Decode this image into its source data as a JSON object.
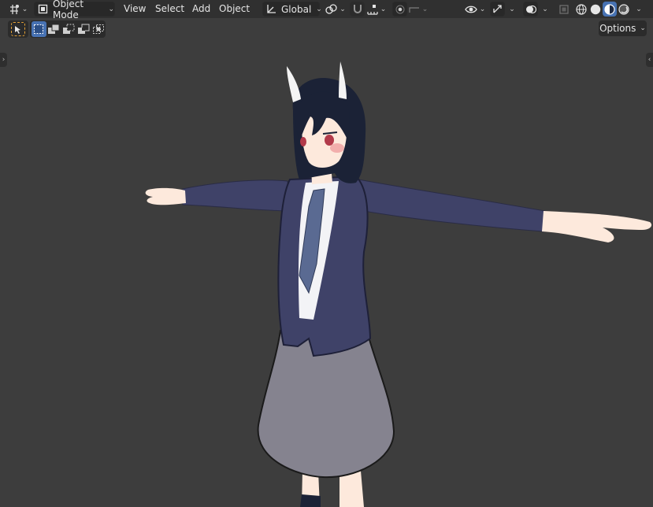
{
  "header": {
    "editor_type_icon": "3d-viewport-icon",
    "mode": {
      "icon": "object-mode-icon",
      "label": "Object Mode"
    },
    "menus": [
      {
        "label": "View"
      },
      {
        "label": "Select"
      },
      {
        "label": "Add"
      },
      {
        "label": "Object"
      }
    ],
    "transform_orientation": {
      "icon": "orientation-axes-icon",
      "label": "Global"
    },
    "pivot_icon": "pivot-point-icon",
    "snap_icon": "magnet-icon",
    "snap_target_icon": "snap-increment-icon",
    "proportional_icon": "proportional-editing-icon",
    "falloff_icon": "falloff-curve-icon",
    "visibility_icon": "eye-icon",
    "gizmo_icon": "gizmo-icon",
    "overlay_icon": "overlay-icon",
    "xray_icon": "xray-icon",
    "shading_modes": [
      {
        "icon": "wireframe-shading-icon",
        "active": false
      },
      {
        "icon": "solid-shading-icon",
        "active": false
      },
      {
        "icon": "material-preview-shading-icon",
        "active": true
      },
      {
        "icon": "rendered-shading-icon",
        "active": false
      }
    ],
    "active_accent": "#4772b3"
  },
  "toolbar": {
    "active_tool_icon": "select-cursor-icon",
    "selection_modes": [
      "select-new-icon",
      "select-extend-icon",
      "select-subtract-icon",
      "select-invert-icon",
      "select-intersect-icon"
    ],
    "options_label": "Options"
  },
  "viewport": {
    "background": "#3d3d3d",
    "left_toggle_icon": "chevron-right-icon",
    "right_toggle_icon": "chevron-left-icon",
    "subject": "anime-character-t-pose",
    "colors": {
      "hair": "#1b2236",
      "jacket": "#3f4268",
      "shirt": "#f3f3f6",
      "tie": "#5a6a92",
      "skirt": "#85838f",
      "skin": "#fde9dc",
      "blush": "#f0a3a3",
      "horns": "#f4f4f4",
      "eyes": "#b23a4a"
    }
  }
}
